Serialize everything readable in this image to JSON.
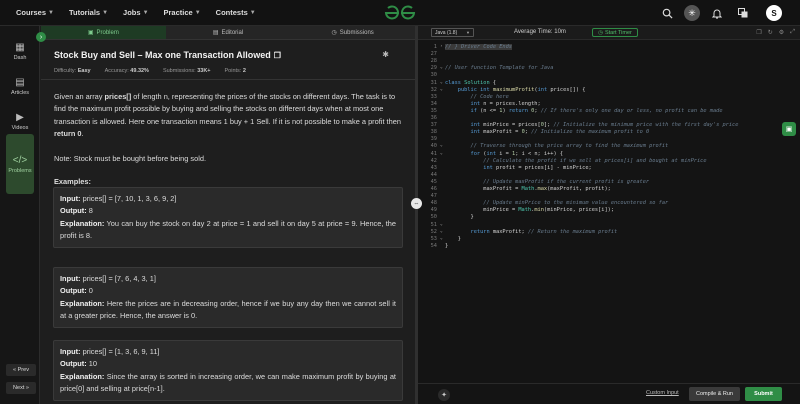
{
  "nav": {
    "items": [
      {
        "label": "Courses"
      },
      {
        "label": "Tutorials"
      },
      {
        "label": "Jobs"
      },
      {
        "label": "Practice"
      },
      {
        "label": "Contests"
      }
    ],
    "avatar_letter": "S",
    "brand_color": "#2f8d46"
  },
  "sidebar": {
    "items": [
      {
        "label": "Dash",
        "icon": "grid-icon"
      },
      {
        "label": "Articles",
        "icon": "document-icon"
      },
      {
        "label": "Videos",
        "icon": "play-icon"
      },
      {
        "label": "Problems",
        "icon": "code-icon"
      }
    ],
    "prev_label": "« Prev",
    "next_label": "Next »"
  },
  "tabs": [
    {
      "label": "Problem"
    },
    {
      "label": "Editorial"
    },
    {
      "label": "Submissions"
    }
  ],
  "problem": {
    "title": "Stock Buy and Sell – Max one Transaction Allowed",
    "difficulty_label": "Difficulty:",
    "difficulty": "Easy",
    "accuracy_label": "Accuracy:",
    "accuracy": "49.32%",
    "submissions_label": "Submissions:",
    "submissions": "33K+",
    "points_label": "Points:",
    "points": "2",
    "desc_p1": "Given an array ",
    "desc_b1": "prices[]",
    "desc_p2": " of length n, representing the prices of the stocks on different days. The task is to find the maximum profit possible by buying and selling the stocks on different days when at most one transaction is allowed. Here one transaction means 1 buy + 1 Sell. If it is not possible to make a profit then ",
    "desc_b2": "return 0",
    "desc_p3": ".",
    "note": "Note: Stock must be bought before being sold.",
    "examples_heading": "Examples:",
    "input_label": "Input:",
    "output_label": "Output:",
    "explanation_label": "Explanation:",
    "examples": [
      {
        "input": "prices[] = [7, 10, 1, 3, 6, 9, 2]",
        "output": "8",
        "explanation": "You can buy the stock on day 2 at price = 1 and sell it on day 5 at price = 9. Hence, the profit is 8."
      },
      {
        "input": "prices[] = [7, 6, 4, 3, 1]",
        "output": "0",
        "explanation": "Here the prices are in decreasing order, hence if we buy any day then we cannot sell it at a greater price. Hence, the answer is 0."
      },
      {
        "input": "prices[] = [1, 3, 6, 9, 11]",
        "output": "10",
        "explanation": "Since the array is sorted in increasing order, we can make maximum profit by buying at price[0] and selling at price[n-1]."
      }
    ]
  },
  "editor": {
    "language": "Java (1.8)",
    "avg_time_label": "Average Time:",
    "avg_time": "10m",
    "timer_label": "Start Timer",
    "custom_input": "Custom Input",
    "compile_label": "Compile & Run",
    "submit_label": "Submit",
    "header_comment": "// } Driver Code Ends",
    "line_numbers": [
      "1",
      "27",
      "28",
      "29",
      "30",
      "31",
      "32",
      "33",
      "34",
      "35",
      "36",
      "37",
      "38",
      "39",
      "40",
      "41",
      "42",
      "43",
      "44",
      "45",
      "46",
      "47",
      "48",
      "49",
      "50",
      "51",
      "52",
      "53",
      "54"
    ],
    "lines": [
      {
        "text": "// } Driver Code Ends",
        "cls": "cm"
      },
      {
        "text": "",
        "cls": ""
      },
      {
        "text": "",
        "cls": ""
      },
      {
        "text": "// User function Template for Java",
        "cls": "cm"
      },
      {
        "text": "",
        "cls": ""
      },
      {
        "text": "class Solution {",
        "cls": "mix1"
      },
      {
        "text": "    public int maximumProfit(int prices[]) {",
        "cls": "mix2"
      },
      {
        "text": "        // Code here",
        "cls": "cm"
      },
      {
        "text": "        int n = prices.length;",
        "cls": "mix3"
      },
      {
        "text": "        if (n <= 1) return 0; // If there's only one day or less, no profit can be made",
        "cls": "mix4"
      },
      {
        "text": "",
        "cls": ""
      },
      {
        "text": "        int minPrice = prices[0]; // Initialize the minimum price with the first day's price",
        "cls": "mix5"
      },
      {
        "text": "        int maxProfit = 0; // Initialize the maximum profit to 0",
        "cls": "mix6"
      },
      {
        "text": "",
        "cls": ""
      },
      {
        "text": "        // Traverse through the price array to find the maximum profit",
        "cls": "cm"
      },
      {
        "text": "        for (int i = 1; i < n; i++) {",
        "cls": "mix7"
      },
      {
        "text": "            // Calculate the profit if we sell at prices[i] and bought at minPrice",
        "cls": "cm"
      },
      {
        "text": "            int profit = prices[i] - minPrice;",
        "cls": "mix8"
      },
      {
        "text": "",
        "cls": ""
      },
      {
        "text": "            // Update maxProfit if the current profit is greater",
        "cls": "cm"
      },
      {
        "text": "            maxProfit = Math.max(maxProfit, profit);",
        "cls": "mix9"
      },
      {
        "text": "",
        "cls": ""
      },
      {
        "text": "            // Update minPrice to the minimum value encountered so far",
        "cls": "cm"
      },
      {
        "text": "            minPrice = Math.min(minPrice, prices[i]);",
        "cls": "mix9"
      },
      {
        "text": "        }",
        "cls": ""
      },
      {
        "text": "",
        "cls": ""
      },
      {
        "text": "        return maxProfit; // Return the maximum profit",
        "cls": "mix10"
      },
      {
        "text": "    }",
        "cls": ""
      },
      {
        "text": "}",
        "cls": ""
      }
    ]
  }
}
